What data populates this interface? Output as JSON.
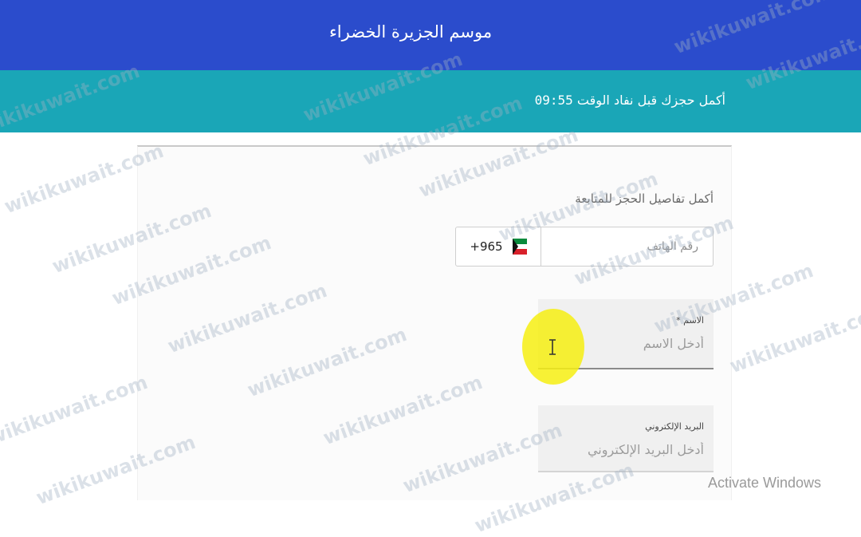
{
  "header": {
    "title": "موسم الجزيرة الخضراء"
  },
  "timer": {
    "message": "أكمل حجزك قبل نفاد الوقت",
    "time": "09:55"
  },
  "form": {
    "instruction": "أكمل تفاصيل الحجز للمتابعة",
    "phone": {
      "country_code": "+965",
      "placeholder": "رقم الهاتف",
      "flag_icon": "kuwait-flag-icon"
    },
    "name": {
      "label": "الاسم *",
      "placeholder": "أدخل الاسم"
    },
    "email": {
      "label": "البريد الإلكتروني",
      "placeholder": "أدخل البريد الإلكتروني"
    }
  },
  "watermark_text": "wikikuwait.com",
  "os_notice": "Activate Windows",
  "colors": {
    "header": "#2b4ccc",
    "timer_bar": "#1aa6b7",
    "cursor_highlight": "#f6ee12"
  }
}
